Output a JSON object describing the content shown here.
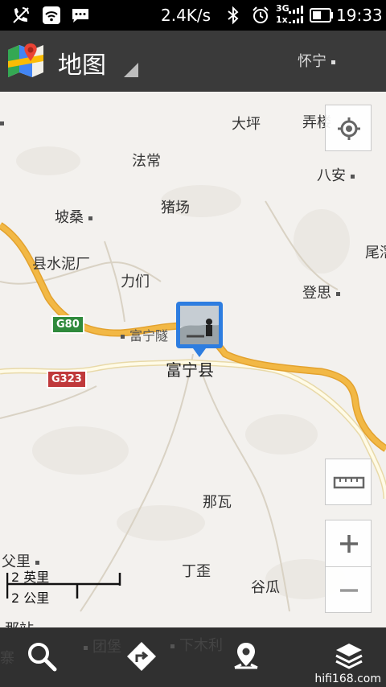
{
  "status_bar": {
    "speed": "2.4K/s",
    "network": "3G",
    "network2": "1x",
    "time": "19:33"
  },
  "app_bar": {
    "title": "地图"
  },
  "map": {
    "places": {
      "huaining": "怀宁",
      "dageping": "大坪",
      "nonglou": "弄楼",
      "fachang": "法常",
      "baan": "八安",
      "zhuchang": "猪场",
      "posang": "坡桑",
      "weiyu": "尾滘",
      "xianshuinichang": "县水泥厂",
      "limen": "力们",
      "dengsi": "登思",
      "funingsui": "富宁隧",
      "funingxian": "富宁县",
      "nawa": "那瓦",
      "fuli": "父里",
      "dingwai": "丁歪",
      "gugua": "谷瓜",
      "nazhan": "那站",
      "zhai": "寨",
      "tuanbao": "团堡",
      "xiamuli": "下木利"
    },
    "shields": {
      "g80": "G80",
      "g323": "G323"
    },
    "scale": {
      "imperial": "2 英里",
      "metric": "2 公里"
    }
  },
  "watermark": "hifi168.com",
  "colors": {
    "road_major": "#f2b845",
    "road_minor": "#fffbe7",
    "map_bg": "#f3f1ee",
    "marker_blue": "#2d7de0"
  }
}
